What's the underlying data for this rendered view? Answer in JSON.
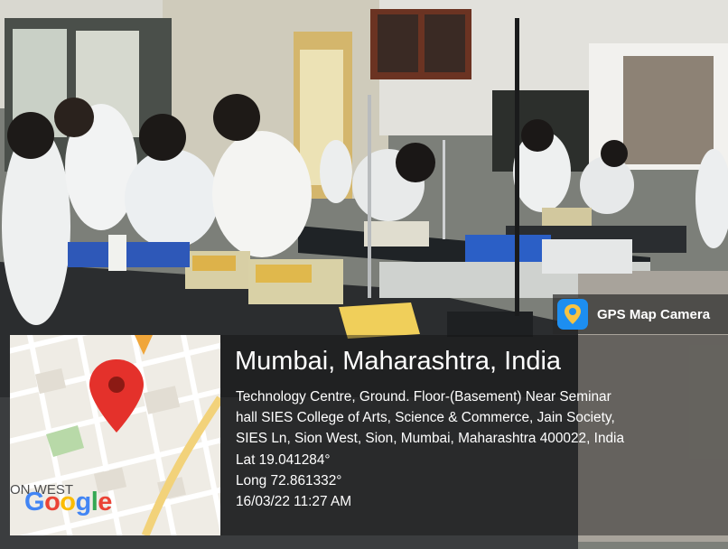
{
  "badge": {
    "label": "GPS Map Camera",
    "icon": "map-pin-icon"
  },
  "location": {
    "place": "Mumbai, Maharashtra, India",
    "address_lines": [
      "Technology Centre, Ground. Floor-(Basement) Near Seminar",
      "hall SIES College of Arts, Science & Commerce, Jain Society,",
      "SIES Ln, Sion West, Sion, Mumbai, Maharashtra 400022, India"
    ],
    "lat": "Lat 19.041284°",
    "long": "Long 72.861332°",
    "datetime": "16/03/22 11:27 AM"
  },
  "map": {
    "street_label": "ON WEST",
    "logo": "Google",
    "pin_icon": "map-pin-icon",
    "colors": {
      "land": "#efece5",
      "road": "#ffffff",
      "highway": "#f2d27a",
      "park": "#b8d9a8",
      "pin": "#e4312b"
    }
  }
}
